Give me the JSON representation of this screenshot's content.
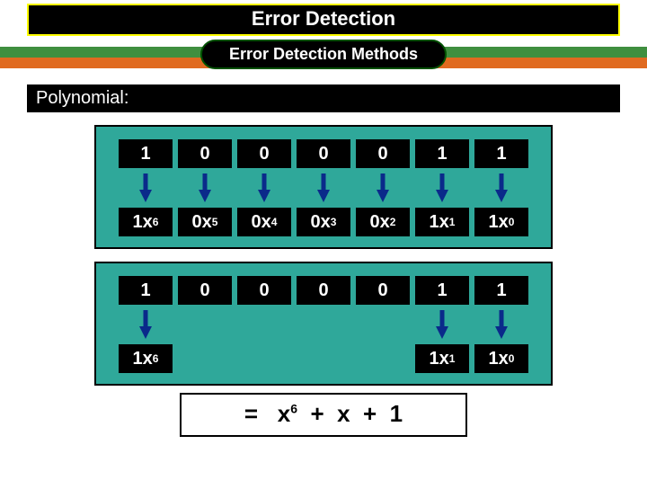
{
  "title": "Error Detection",
  "subtitle": "Error Detection Methods",
  "label": "Polynomial:",
  "bits": [
    "1",
    "0",
    "0",
    "0",
    "0",
    "1",
    "1"
  ],
  "terms_full": [
    {
      "coef": "1",
      "exp": "6"
    },
    {
      "coef": "0",
      "exp": "5"
    },
    {
      "coef": "0",
      "exp": "4"
    },
    {
      "coef": "0",
      "exp": "3"
    },
    {
      "coef": "0",
      "exp": "2"
    },
    {
      "coef": "1",
      "exp": "1"
    },
    {
      "coef": "1",
      "exp": "0"
    }
  ],
  "terms_kept": [
    {
      "coef": "1",
      "exp": "6",
      "show": true
    },
    {
      "coef": "0",
      "exp": "5",
      "show": false
    },
    {
      "coef": "0",
      "exp": "4",
      "show": false
    },
    {
      "coef": "0",
      "exp": "3",
      "show": false
    },
    {
      "coef": "0",
      "exp": "2",
      "show": false
    },
    {
      "coef": "1",
      "exp": "1",
      "show": true
    },
    {
      "coef": "1",
      "exp": "0",
      "show": true
    }
  ],
  "result": {
    "eq": "=",
    "parts": [
      "x",
      "6",
      "+",
      "x",
      "",
      "+",
      "1"
    ]
  },
  "colors": {
    "arrow": "#0a2a8a"
  }
}
